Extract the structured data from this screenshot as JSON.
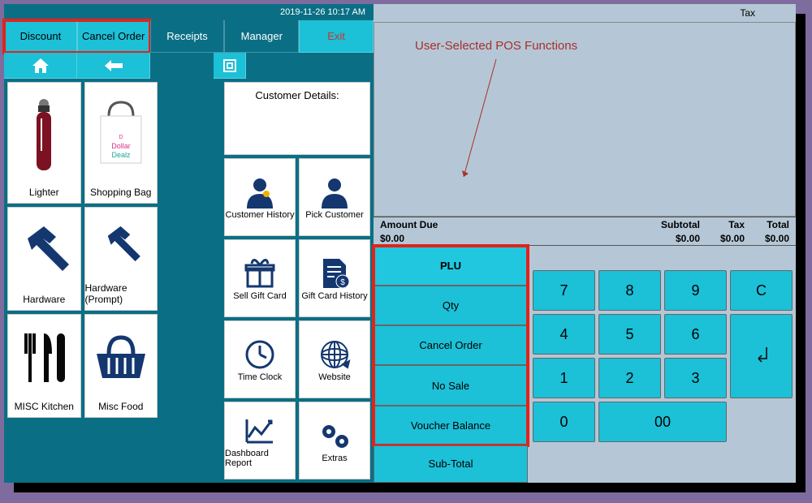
{
  "timestamp": "2019-11-26 10:17 AM",
  "topbar": {
    "discount": "Discount",
    "cancel": "Cancel Order",
    "receipts": "Receipts",
    "manager": "Manager",
    "exit": "Exit"
  },
  "products": {
    "lighter": "Lighter",
    "bag": "Shopping Bag",
    "hardware": "Hardware",
    "hardware_prompt": "Hardware (Prompt)",
    "misc_kitchen": "MISC Kitchen",
    "misc_food": "Misc Food"
  },
  "customer": {
    "header": "Customer Details:",
    "history": "Customer History",
    "pick": "Pick Customer",
    "sell_gc": "Sell Gift Card",
    "gc_history": "Gift Card History",
    "timeclock": "Time Clock",
    "website": "Website",
    "dashboard": "Dashboard Report",
    "extras": "Extras"
  },
  "right": {
    "tax_label": "Tax",
    "annotation": "User-Selected POS Functions",
    "amount_due_label": "Amount Due",
    "amount_due": "$0.00",
    "subtotal_label": "Subtotal",
    "subtotal": "$0.00",
    "tax_col_label": "Tax",
    "tax_val": "$0.00",
    "total_label": "Total",
    "total": "$0.00"
  },
  "funcs": {
    "plu": "PLU",
    "qty": "Qty",
    "cancel": "Cancel Order",
    "nosale": "No Sale",
    "voucher": "Voucher Balance",
    "subtotal": "Sub-Total"
  },
  "keys": {
    "k7": "7",
    "k8": "8",
    "k9": "9",
    "kc": "C",
    "k4": "4",
    "k5": "5",
    "k6": "6",
    "k1": "1",
    "k2": "2",
    "k3": "3",
    "k0": "0",
    "k00": "00",
    "enter": "↵"
  }
}
